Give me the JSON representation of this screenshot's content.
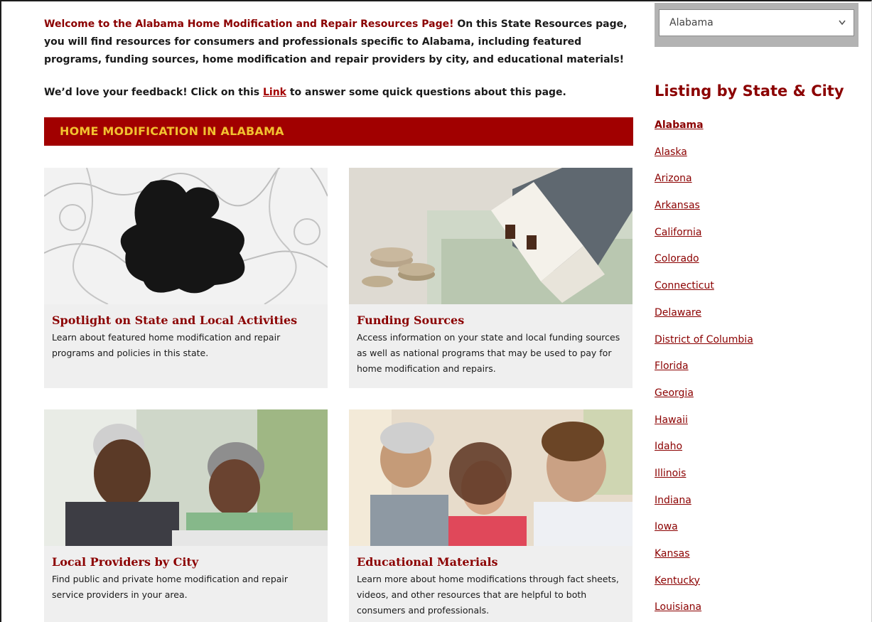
{
  "intro": {
    "lead": "Welcome to the Alabama Home Modification and Repair Resources Page!",
    "rest": " On this State Resources page, you will find resources for consumers and professionals specific to Alabama, including featured programs, funding sources, home modification and repair providers by city, and educational materials!"
  },
  "feedback": {
    "before": "We’d love your feedback! Click on this ",
    "link": "Link",
    "after": " to answer some quick questions about this page."
  },
  "banner": "HOME MODIFICATION IN ALABAMA",
  "cards": [
    {
      "title": "Spotlight on State and Local Activities",
      "desc": "Learn about featured home modification and repair programs and policies in this state."
    },
    {
      "title": "Funding Sources",
      "desc": "Access information on your state and local funding sources as well as national programs that may be used to pay for home modification and repairs."
    },
    {
      "title": "Local Providers by City",
      "desc": "Find public and private home modification and repair service providers in your area."
    },
    {
      "title": "Educational Materials",
      "desc": "Learn more about home modifications through fact sheets, videos, and other resources that are helpful to both consumers and professionals."
    }
  ],
  "sidebar": {
    "select_value": "Alabama",
    "title": "Listing by State & City",
    "states": [
      "Alabama",
      "Alaska",
      "Arizona",
      "Arkansas",
      "California",
      "Colorado",
      "Connecticut",
      "Delaware",
      "District of Columbia",
      "Florida",
      "Georgia",
      "Hawaii",
      "Idaho",
      "Illinois",
      "Indiana",
      "Iowa",
      "Kansas",
      "Kentucky",
      "Louisiana"
    ]
  },
  "colors": {
    "accent": "#8b0000",
    "banner_bg": "#a10000",
    "banner_text": "#f2c230"
  }
}
